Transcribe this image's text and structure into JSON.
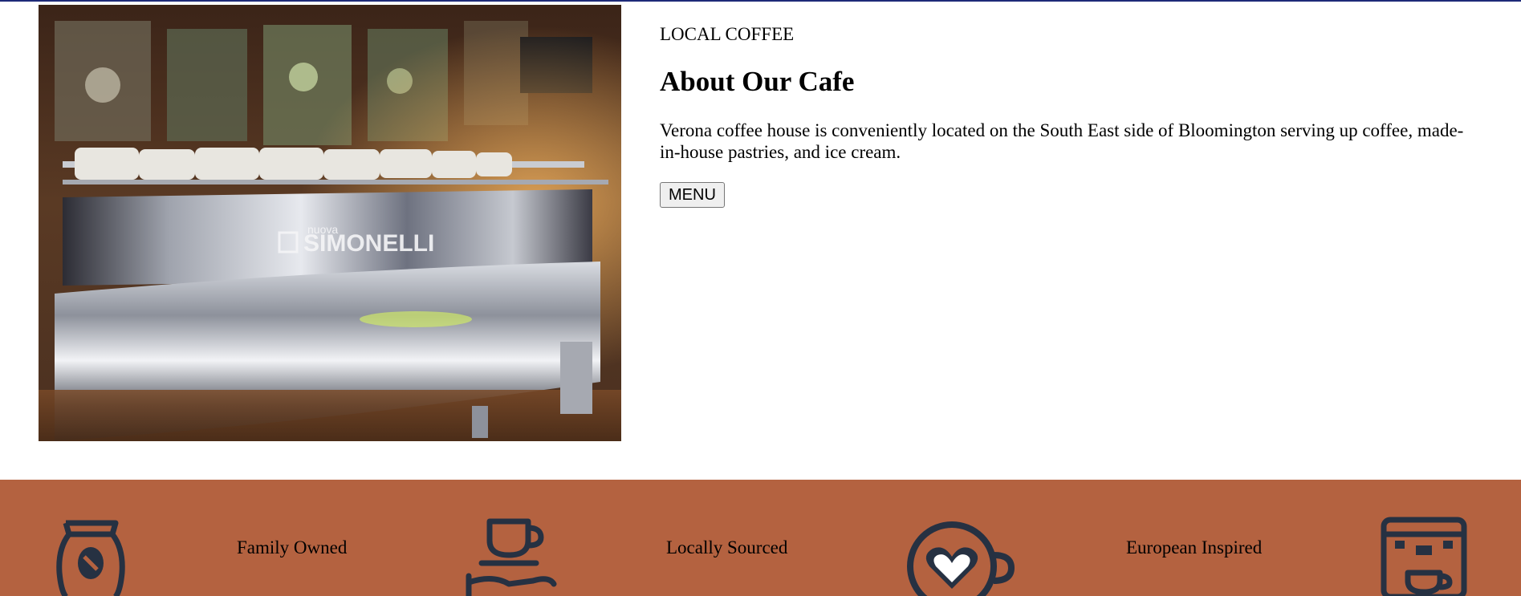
{
  "hero": {
    "image_alt": "Nuova Simonelli espresso machine",
    "image_brand_text": "SIMONELLI",
    "image_brand_small": "nuova"
  },
  "about": {
    "eyebrow": "LOCAL COFFEE",
    "title": "About Our Cafe",
    "text": "Verona coffee house is conveniently located on the South East side of Bloomington serving up coffee, made-in-house pastries, and ice cream.",
    "menu_button": "MENU"
  },
  "features": {
    "items": [
      {
        "label": "Family Owned",
        "icon": "coffee-bag-icon"
      },
      {
        "label": "Locally Sourced",
        "icon": "hand-coffee-cup-icon"
      },
      {
        "label": "European Inspired",
        "icon": "latte-heart-icon"
      },
      {
        "label": "",
        "icon": "espresso-machine-icon"
      }
    ],
    "background": "#b46240",
    "icon_color": "#263142"
  },
  "colors": {
    "top_line": "#1e2a78"
  }
}
